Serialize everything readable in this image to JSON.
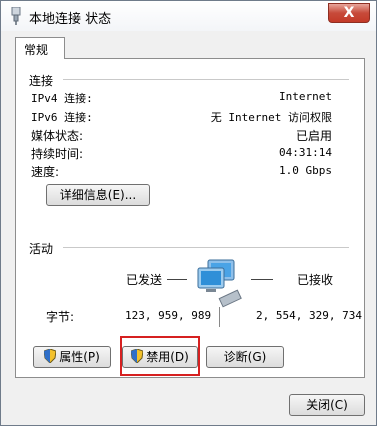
{
  "window": {
    "title": "本地连接 状态",
    "close_label": "X"
  },
  "tabs": [
    {
      "label": "常规"
    }
  ],
  "connection": {
    "heading": "连接",
    "rows": [
      {
        "label": "IPv4 连接:",
        "value": "Internet"
      },
      {
        "label": "IPv6 连接:",
        "value": "无 Internet 访问权限"
      },
      {
        "label": "媒体状态:",
        "value": "已启用"
      },
      {
        "label": "持续时间:",
        "value": "04:31:14"
      },
      {
        "label": "速度:",
        "value": "1.0 Gbps"
      }
    ],
    "details_button": "详细信息(E)..."
  },
  "activity": {
    "heading": "活动",
    "sent_label": "已发送",
    "received_label": "已接收",
    "bytes_label": "字节:",
    "bytes_sent": "123, 959, 989",
    "bytes_received": "2, 554, 329, 734"
  },
  "buttons": {
    "properties": "属性(P)",
    "disable": "禁用(D)",
    "diagnose": "诊断(G)",
    "close": "关闭(C)"
  },
  "icons": {
    "title": "network-adapter-icon",
    "activity": "computer-network-icon",
    "shield": "uac-shield-icon"
  }
}
